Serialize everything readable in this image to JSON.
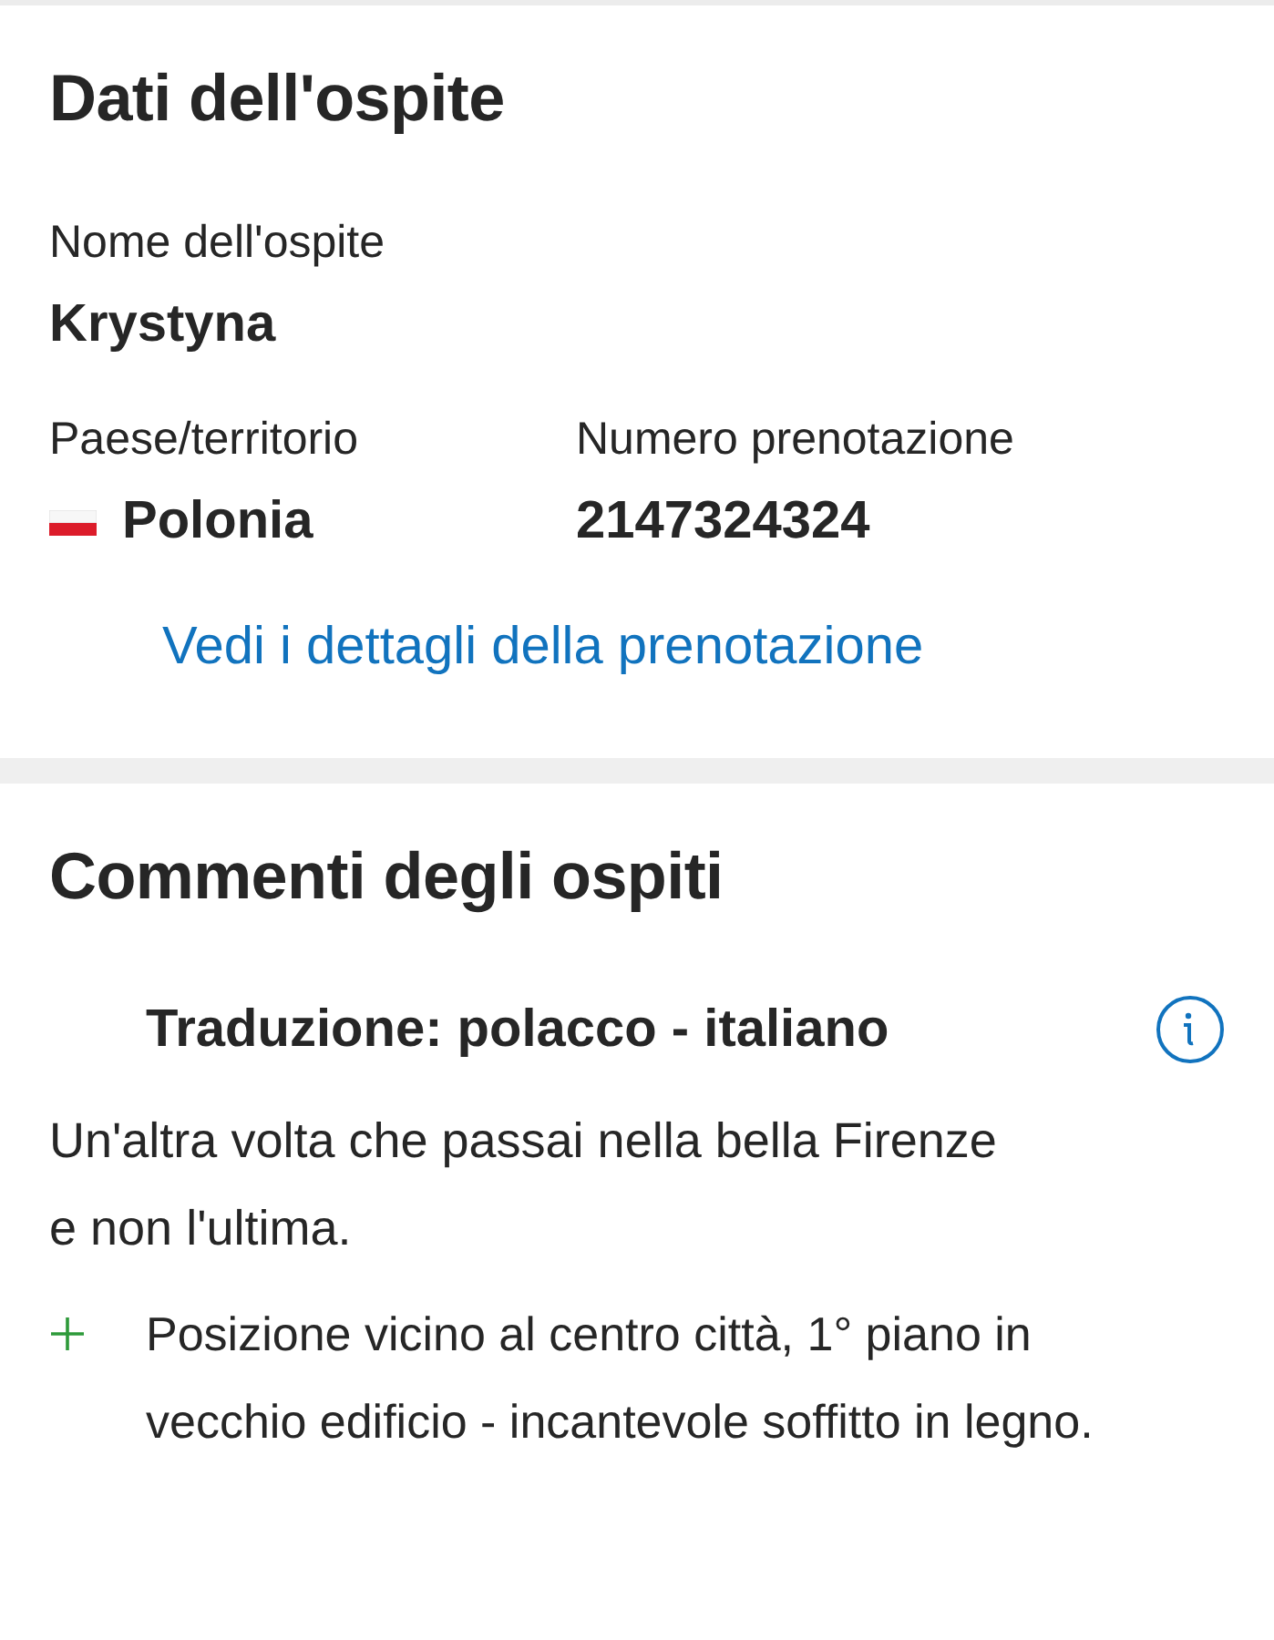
{
  "guest_details": {
    "title": "Dati dell'ospite",
    "name_label": "Nome dell'ospite",
    "name": "Krystyna",
    "country_label": "Paese/territorio",
    "country": "Polonia",
    "booking_label": "Numero prenotazione",
    "booking_number": "2147324324",
    "details_link": "Vedi i dettagli della prenotazione"
  },
  "guest_comments": {
    "title": "Commenti degli ospiti",
    "translation": "Traduzione: polacco - italiano",
    "comment": "Un'altra volta che passai nella bella Firenze e non l'ultima.",
    "points": [
      {
        "kind": "positive",
        "text": "Posizione vicino al centro città, 1° piano in vecchio edificio - incantevole soffitto in legno."
      }
    ]
  }
}
